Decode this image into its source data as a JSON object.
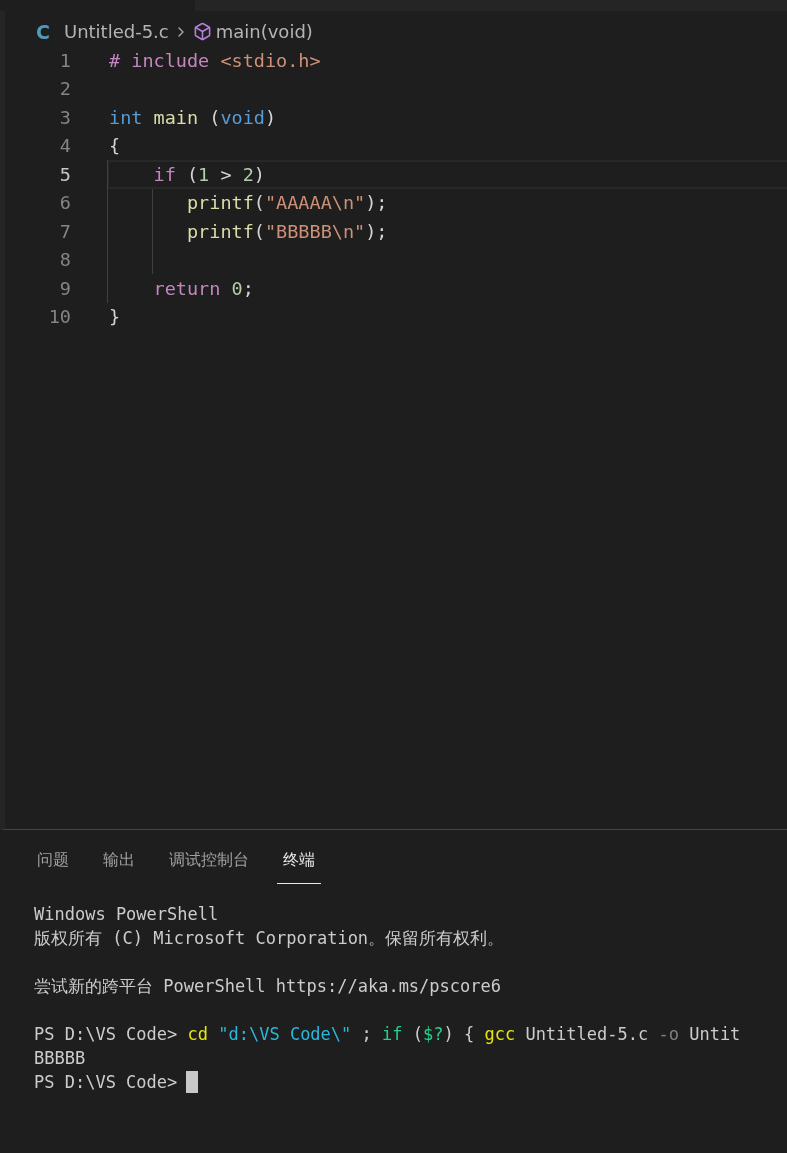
{
  "breadcrumb": {
    "file_icon": "C",
    "file": "Untitled-5.c",
    "symbol": "main(void)"
  },
  "editor": {
    "lines": [
      {
        "number": "1",
        "current": false,
        "tokens": [
          {
            "text": "# include",
            "kind": "directive"
          },
          {
            "text": " <stdio.h>",
            "kind": "string"
          }
        ]
      },
      {
        "number": "2",
        "current": false
      },
      {
        "number": "3",
        "current": false,
        "tokens": [
          {
            "text": "int",
            "kind": "type"
          },
          {
            "text": " main",
            "kind": "function"
          },
          {
            "text": " (",
            "kind": "plain"
          },
          {
            "text": "void",
            "kind": "type"
          },
          {
            "text": ")",
            "kind": "plain"
          }
        ]
      },
      {
        "number": "4",
        "current": false,
        "tokens": [
          {
            "text": "{",
            "kind": "plain"
          }
        ]
      },
      {
        "number": "5",
        "current": true,
        "tokens": [
          {
            "text": "    if",
            "kind": "control"
          },
          {
            "text": " (",
            "kind": "plain"
          },
          {
            "text": "1",
            "kind": "number"
          },
          {
            "text": " > ",
            "kind": "plain"
          },
          {
            "text": "2",
            "kind": "number"
          },
          {
            "text": ")",
            "kind": "plain"
          }
        ]
      },
      {
        "number": "6",
        "current": false,
        "tokens": [
          {
            "text": "       printf",
            "kind": "function"
          },
          {
            "text": "(",
            "kind": "plain"
          },
          {
            "text": "\"AAAAA\\n\"",
            "kind": "string"
          },
          {
            "text": ");",
            "kind": "plain"
          }
        ]
      },
      {
        "number": "7",
        "current": false,
        "tokens": [
          {
            "text": "       printf",
            "kind": "function"
          },
          {
            "text": "(",
            "kind": "plain"
          },
          {
            "text": "\"BBBBB\\n\"",
            "kind": "string"
          },
          {
            "text": ");",
            "kind": "plain"
          }
        ]
      },
      {
        "number": "8",
        "current": false
      },
      {
        "number": "9",
        "current": false,
        "tokens": [
          {
            "text": "    return",
            "kind": "control"
          },
          {
            "text": " 0",
            "kind": "number"
          },
          {
            "text": ";",
            "kind": "plain"
          }
        ]
      },
      {
        "number": "10",
        "current": false,
        "tokens": [
          {
            "text": "}",
            "kind": "plain"
          }
        ]
      }
    ]
  },
  "panel": {
    "tabs": [
      {
        "label": "问题",
        "selected": false
      },
      {
        "label": "输出",
        "selected": false
      },
      {
        "label": "调试控制台",
        "selected": false
      },
      {
        "label": "终端",
        "selected": true
      }
    ],
    "terminal": {
      "blocks": [
        [
          {
            "tokens": [
              {
                "text": "Windows PowerShell",
                "kind": "plain"
              }
            ]
          },
          {
            "tokens": [
              {
                "text": "版权所有 (C) Microsoft Corporation。保留所有权利。",
                "kind": "plain"
              }
            ]
          }
        ],
        [
          {
            "tokens": [
              {
                "text": "尝试新的跨平台 PowerShell https://aka.ms/pscore6",
                "kind": "plain"
              }
            ]
          }
        ],
        [
          {
            "tokens": [
              {
                "text": "PS D:\\VS Code>",
                "kind": "plain"
              },
              {
                "text": " cd",
                "kind": "command"
              },
              {
                "text": " \"d:\\VS Code\\\"",
                "kind": "string"
              },
              {
                "text": " ;",
                "kind": "plain"
              },
              {
                "text": " if",
                "kind": "keyword"
              },
              {
                "text": " (",
                "kind": "plain"
              },
              {
                "text": "$?",
                "kind": "keyword"
              },
              {
                "text": ") {",
                "kind": "plain"
              },
              {
                "text": " gcc",
                "kind": "command"
              },
              {
                "text": " Untitled-5.c",
                "kind": "plain"
              },
              {
                "text": " -o",
                "kind": "param"
              },
              {
                "text": " Untit",
                "kind": "plain"
              }
            ]
          },
          {
            "tokens": [
              {
                "text": "BBBBB",
                "kind": "plain"
              }
            ]
          },
          {
            "tokens": [
              {
                "text": "PS D:\\VS Code>",
                "kind": "plain"
              }
            ],
            "cursor": true
          }
        ]
      ]
    }
  }
}
